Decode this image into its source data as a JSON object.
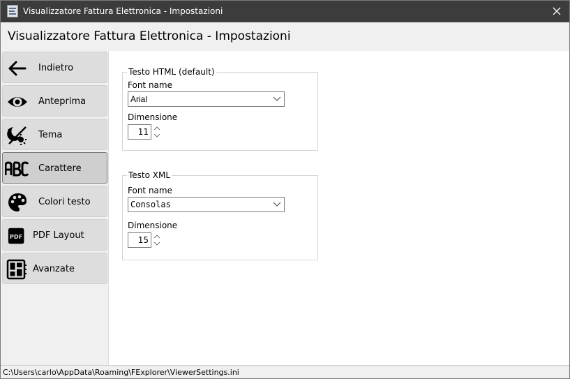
{
  "window": {
    "title": "Visualizzatore Fattura Elettronica - Impostazioni"
  },
  "header": {
    "title": "Visualizzatore Fattura Elettronica - Impostazioni"
  },
  "sidebar": {
    "items": [
      {
        "label": "Indietro",
        "icon": "arrow-left-icon"
      },
      {
        "label": "Anteprima",
        "icon": "eye-icon"
      },
      {
        "label": "Tema",
        "icon": "theme-icon"
      },
      {
        "label": "Carattere",
        "icon": "abc-font-icon",
        "active": true
      },
      {
        "label": "Colori testo",
        "icon": "palette-icon"
      },
      {
        "label": "PDF Layout",
        "icon": "pdf-icon"
      },
      {
        "label": "Avanzate",
        "icon": "dashboard-icon"
      }
    ]
  },
  "html_group": {
    "legend": "Testo HTML (default)",
    "font_label": "Font name",
    "font_value": "Arial",
    "size_label": "Dimensione",
    "size_value": "11"
  },
  "xml_group": {
    "legend": "Testo XML",
    "font_label": "Font name",
    "font_value": "Consolas",
    "size_label": "Dimensione",
    "size_value": "15"
  },
  "status": {
    "path": "C:\\Users\\carlo\\AppData\\Roaming\\FExplorer\\ViewerSettings.ini"
  },
  "colors": {
    "titlebar": "#3c3c3c",
    "sidebar_bg": "#f0f0f0",
    "nav_button": "#dddddd",
    "nav_button_active": "#cfcfcf"
  }
}
